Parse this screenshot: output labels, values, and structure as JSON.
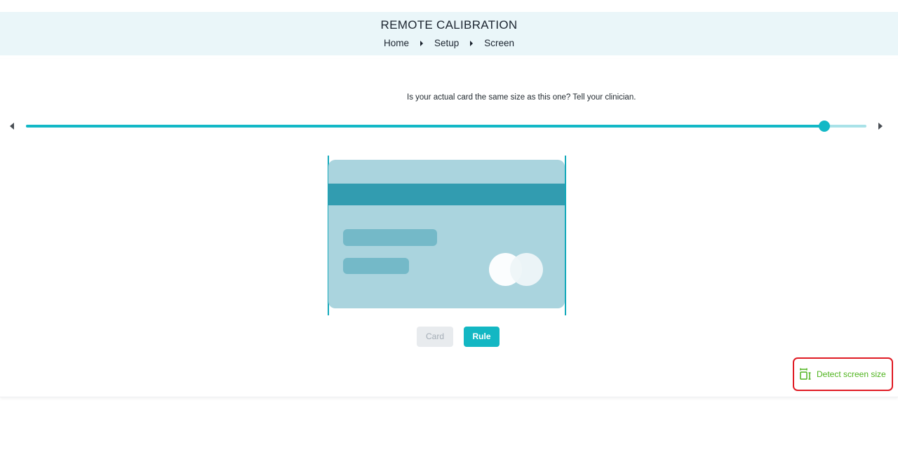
{
  "header": {
    "title": "REMOTE CALIBRATION",
    "breadcrumb": [
      "Home",
      "Setup",
      "Screen"
    ]
  },
  "main": {
    "instruction": "Is your actual card the same size as this one? Tell your clinician.",
    "slider": {
      "value_fraction": 0.95
    },
    "toggle": {
      "card_label": "Card",
      "rule_label": "Rule",
      "selected": "Rule"
    },
    "detect_button": {
      "label": "Detect screen size",
      "icon": "screen-size-icon"
    }
  },
  "colors": {
    "accent": "#12b8c6",
    "header_bg": "#eaf6f9",
    "card_bg": "#aad4de",
    "card_stripe": "#329cb0",
    "detect_text": "#4fb41e",
    "highlight_border": "#e01b24"
  }
}
